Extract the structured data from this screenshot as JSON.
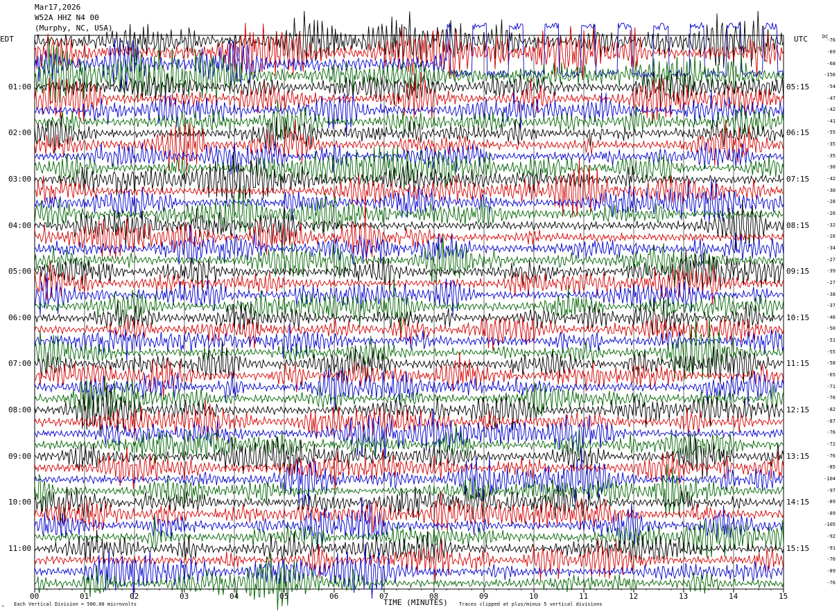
{
  "header": {
    "date": "Mar17,2026",
    "station": "W52A HHZ N4 00",
    "location": "(Murphy, NC, USA)"
  },
  "left_zone": "EDT",
  "right_zone": "UTC",
  "dc_label": "DC",
  "footer": {
    "scale_text": "Each Vertical Division =  500.00 microvolts",
    "clip_text": "Traces clipped at plus/minus 5 vertical divisions",
    "corner_mark": "^"
  },
  "colors": {
    "palette": [
      "#000000",
      "#d40000",
      "#0000cc",
      "#006400"
    ],
    "grid": "#000000"
  },
  "chart_data": {
    "type": "line",
    "title": "",
    "xlabel": "TIME (MINUTES)",
    "ylabel": "",
    "xlim": [
      0,
      15
    ],
    "x_ticks": [
      "00",
      "01",
      "02",
      "03",
      "04",
      "05",
      "06",
      "07",
      "08",
      "09",
      "10",
      "11",
      "12",
      "13",
      "14",
      "15"
    ],
    "left_time_labels": [
      "01:00",
      "02:00",
      "03:00",
      "04:00",
      "05:00",
      "06:00",
      "07:00",
      "08:00",
      "09:00",
      "10:00",
      "11:00"
    ],
    "right_time_labels": [
      "05:15",
      "06:15",
      "07:15",
      "08:15",
      "09:15",
      "10:15",
      "11:15",
      "12:15",
      "13:15",
      "14:15",
      "15:15"
    ],
    "dc_offsets": [
      -76,
      -69,
      -68,
      -156,
      -54,
      -47,
      -42,
      -41,
      -55,
      -35,
      -35,
      -30,
      -42,
      -30,
      -28,
      -26,
      -32,
      -16,
      -34,
      -27,
      -39,
      -27,
      -38,
      -37,
      -46,
      -50,
      -51,
      -55,
      -58,
      -65,
      -71,
      -76,
      -82,
      -87,
      -76,
      -72,
      -76,
      -85,
      -104,
      -97,
      -89,
      -89,
      -105,
      -92,
      -91,
      -76,
      -89,
      -76
    ],
    "trace_count": 48,
    "minutes_per_trace": 15,
    "colors_cycle": [
      "black",
      "red",
      "blue",
      "green"
    ],
    "grid": true
  }
}
